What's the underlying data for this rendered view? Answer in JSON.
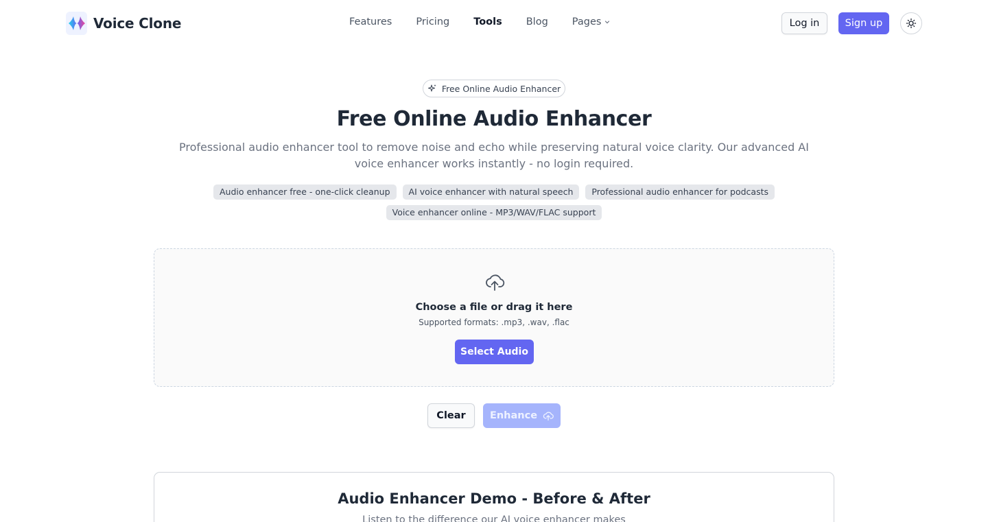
{
  "header": {
    "brand_name": "Voice Clone",
    "nav": [
      {
        "label": "Features"
      },
      {
        "label": "Pricing"
      },
      {
        "label": "Tools"
      },
      {
        "label": "Blog"
      },
      {
        "label": "Pages"
      }
    ],
    "login_label": "Log in",
    "signup_label": "Sign up"
  },
  "hero": {
    "pill_label": "Free Online Audio Enhancer",
    "title": "Free Online Audio Enhancer",
    "subtitle": "Professional audio enhancer tool to remove noise and echo while preserving natural voice clarity. Our advanced AI voice enhancer works instantly - no login required.",
    "tags": [
      "Audio enhancer free - one-click cleanup",
      "AI voice enhancer with natural speech",
      "Professional audio enhancer for podcasts",
      "Voice enhancer online - MP3/WAV/FLAC support"
    ]
  },
  "upload": {
    "title": "Choose a file or drag it here",
    "formats": "Supported formats: .mp3, .wav, .flac",
    "select_label": "Select Audio"
  },
  "actions": {
    "clear_label": "Clear",
    "enhance_label": "Enhance"
  },
  "demo": {
    "title": "Audio Enhancer Demo - Before & After",
    "subtitle": "Listen to the difference our AI voice enhancer makes"
  },
  "colors": {
    "primary": "#6366f1",
    "primary_disabled": "#a5b4fc",
    "text_dark": "#1f2937",
    "text_muted": "#6b7280"
  }
}
